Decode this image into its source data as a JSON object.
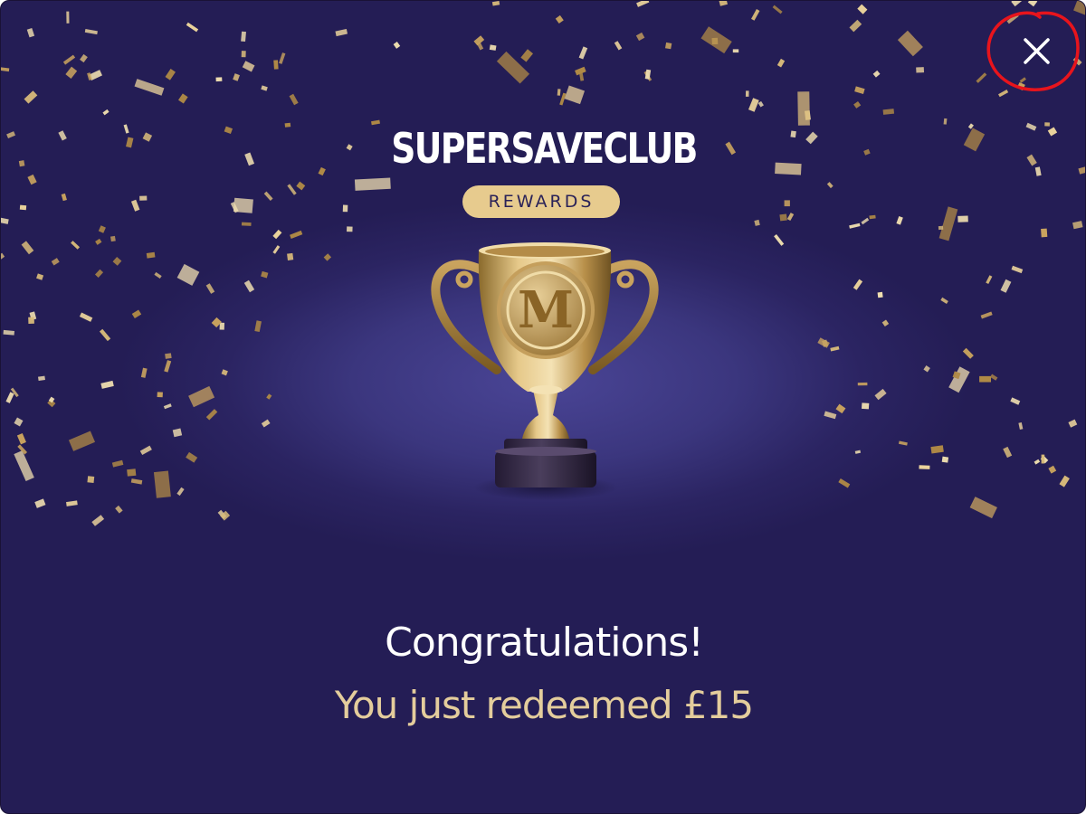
{
  "modal": {
    "brand": "SUPERSAVECLUB",
    "badge": "REWARDS",
    "trophy_letter": "M",
    "headline": "Congratulations!",
    "subline": "You just redeemed £15"
  },
  "icons": {
    "close": "close-icon",
    "trophy": "trophy-icon",
    "confetti": "confetti-decoration"
  },
  "colors": {
    "background": "#2b2462",
    "spotlight": "#4a4596",
    "gold": "#e7cb8e",
    "subline_text": "#e4cd9c",
    "headline_text": "#ffffff",
    "close_highlight": "#e8141c"
  }
}
